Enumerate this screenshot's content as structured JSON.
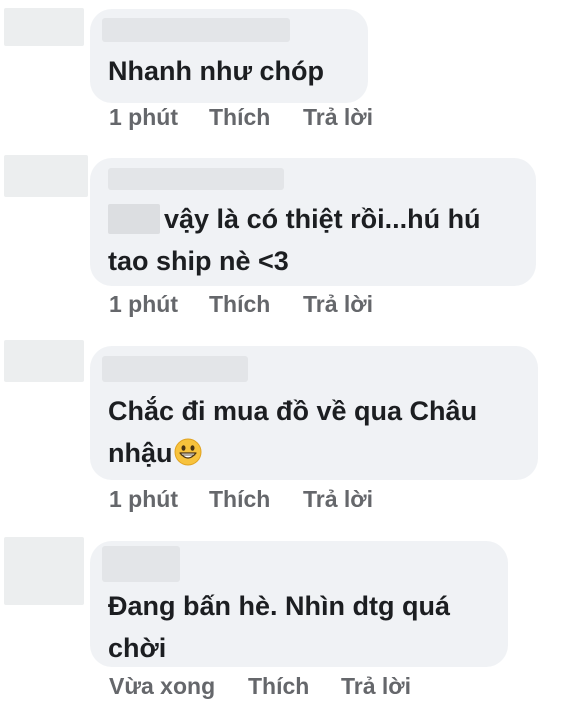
{
  "comments": [
    {
      "text_lines": [
        "Nhanh như chóp"
      ],
      "actions": {
        "time": "1 phút",
        "like": "Thích",
        "reply": "Trả lời"
      }
    },
    {
      "text_lines": [
        "vậy là có thiệt rồi...hú hú",
        "tao ship nè <3"
      ],
      "actions": {
        "time": "1 phút",
        "like": "Thích",
        "reply": "Trả lời"
      }
    },
    {
      "text_lines": [
        "Chắc đi mua đồ về qua Châu",
        "nhậu"
      ],
      "emoji": "grinning-face-emoji",
      "actions": {
        "time": "1 phút",
        "like": "Thích",
        "reply": "Trả lời"
      }
    },
    {
      "text_lines": [
        "Đang bấn hè. Nhìn dtg quá",
        "chời"
      ],
      "actions": {
        "time": "Vừa xong",
        "like": "Thích",
        "reply": "Trả lời"
      }
    }
  ],
  "colors": {
    "bubble": "#f0f2f5",
    "text": "#1c1e21",
    "meta": "#65676b"
  }
}
